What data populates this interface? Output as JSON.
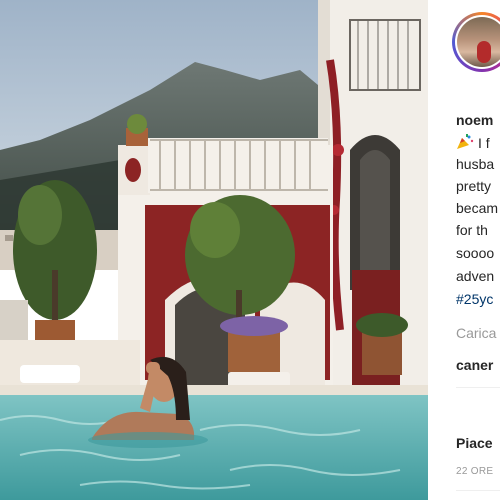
{
  "post": {
    "username": "noem",
    "caption_lines": [
      "I f",
      "husba",
      "pretty",
      "becam",
      "for th",
      "soooo",
      "adven"
    ],
    "hashtag": "#25yc",
    "load_more": "Carica",
    "comment_user": "caner",
    "likes_label": "Piace",
    "timestamp": "22 ORE"
  },
  "icons": {
    "avatar": "profile-avatar-icon",
    "party": "party-popper-icon"
  },
  "colors": {
    "link": "#003569",
    "muted": "#999999",
    "text": "#262626"
  }
}
